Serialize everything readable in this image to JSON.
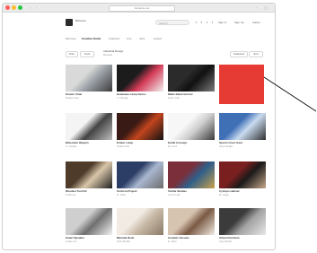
{
  "browser": {
    "url": "behance.net",
    "colors": {
      "close": "#ff5f57",
      "minimize": "#febc2e",
      "maximize": "#28c840"
    }
  },
  "header": {
    "logo_text": "Behance",
    "search_placeholder": "Search",
    "links": [
      "Sign In",
      "Sign Up",
      "Adobe"
    ]
  },
  "subnav": {
    "items": [
      "Discover",
      "Creative Fields",
      "Featured",
      "Live",
      "Jobs",
      "Assets"
    ],
    "active_index": 1
  },
  "filters": {
    "pills": [
      "Filter",
      "Tools"
    ],
    "result_title": "Industrial Design",
    "result_count": "Results",
    "sort_buttons": [
      "Featured",
      "Sort"
    ]
  },
  "cards": [
    {
      "title": "Kinetic Chair",
      "meta": "Studio One",
      "colors": [
        "#d9d9d9",
        "#9aa0a6",
        "#3b3b3b"
      ]
    },
    {
      "title": "Heatwave Lamp Series",
      "meta": "J. Ortega",
      "colors": [
        "#1c1c1c",
        "#d23a56",
        "#f2f2f2"
      ]
    },
    {
      "title": "Matte Black Interior",
      "meta": "Form Lab",
      "colors": [
        "#2b2b2b",
        "#111111",
        "#7c7c7c"
      ]
    },
    {
      "title": "",
      "meta": "",
      "colors": [
        "#e63a35",
        "#e63a35",
        "#e63a35"
      ]
    },
    {
      "title": "Molecular Objects",
      "meta": "A. Novak",
      "colors": [
        "#f4f4f4",
        "#444444",
        "#bdbdbd"
      ]
    },
    {
      "title": "Ember Lamp",
      "meta": "Studio Kiln",
      "colors": [
        "#3a1a14",
        "#c2451e",
        "#111111"
      ]
    },
    {
      "title": "Kettle Concept",
      "meta": "M. Lind",
      "colors": [
        "#f7f7f7",
        "#cfcfcf",
        "#3a3a3a"
      ]
    },
    {
      "title": "Sports Court Gear",
      "meta": "Team Eight",
      "colors": [
        "#3f6fb5",
        "#c9dbf0",
        "#2f2f2f"
      ]
    },
    {
      "title": "Wooden Tool Kit",
      "meta": "Craft Co.",
      "colors": [
        "#4f3b2a",
        "#d9c7aa",
        "#1f1f1f"
      ]
    },
    {
      "title": "Uniform Project",
      "meta": "N. Park",
      "colors": [
        "#2c3e66",
        "#a9b7cf",
        "#6b6b6b"
      ]
    },
    {
      "title": "Textile Studies",
      "meta": "Loom Lab",
      "colors": [
        "#7a2f3a",
        "#2f5e8a",
        "#c9a24a"
      ]
    },
    {
      "title": "Cyclops Helmet",
      "meta": "R. Vega",
      "colors": [
        "#7a1f1f",
        "#1a1a1a",
        "#c8a88a"
      ]
    },
    {
      "title": "Smart Speaker",
      "meta": "Audio Co.",
      "colors": [
        "#cfcfcf",
        "#6f6f6f",
        "#f3f3f3"
      ]
    },
    {
      "title": "Minimal Desk",
      "meta": "Oak Studio",
      "colors": [
        "#f1ebe3",
        "#c8b9a6",
        "#8a7a66"
      ]
    },
    {
      "title": "Ceramic Vessels",
      "meta": "E. Sato",
      "colors": [
        "#d6c3b0",
        "#7a5a44",
        "#f2ece4"
      ]
    },
    {
      "title": "Urban Furniture",
      "meta": "City Works",
      "colors": [
        "#3b3b3b",
        "#a3a3a3",
        "#e8e8e8"
      ]
    }
  ],
  "annotation": {
    "color": "#000000"
  }
}
